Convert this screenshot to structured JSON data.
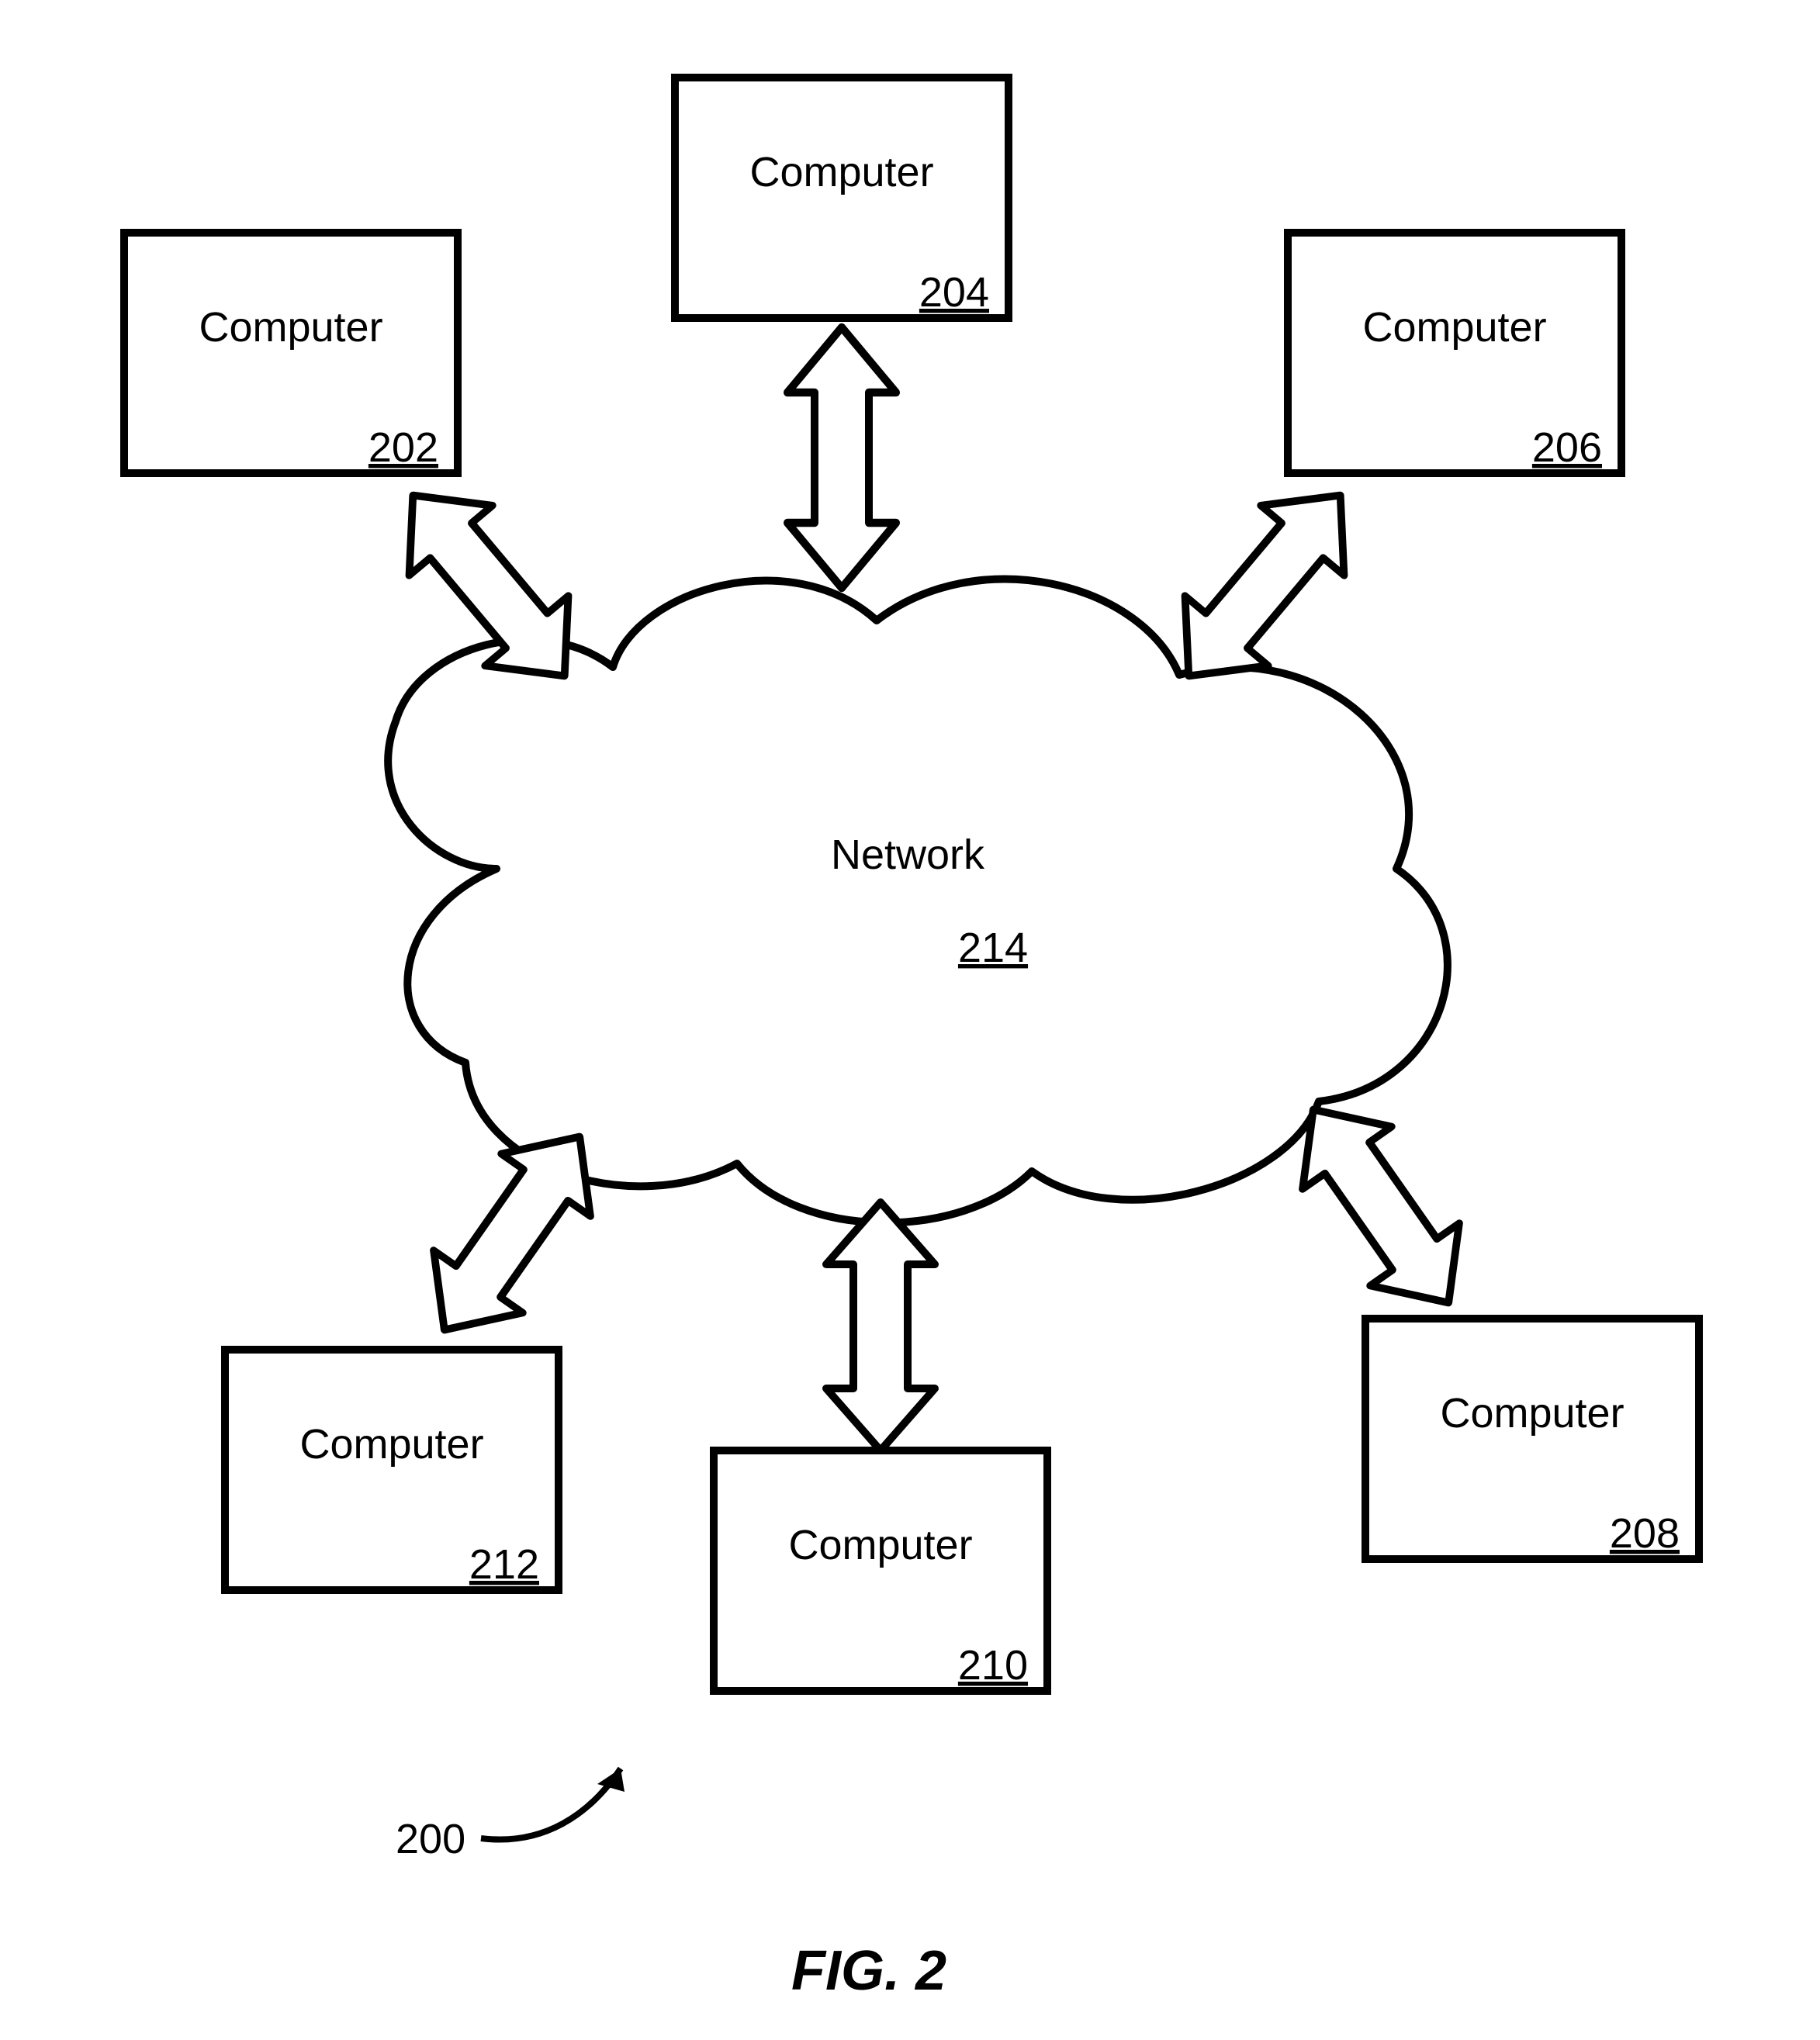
{
  "figure": {
    "caption": "FIG. 2",
    "overall_ref": "200"
  },
  "network": {
    "label": "Network",
    "ref": "214"
  },
  "nodes": {
    "n202": {
      "label": "Computer",
      "ref": "202"
    },
    "n204": {
      "label": "Computer",
      "ref": "204"
    },
    "n206": {
      "label": "Computer",
      "ref": "206"
    },
    "n208": {
      "label": "Computer",
      "ref": "208"
    },
    "n210": {
      "label": "Computer",
      "ref": "210"
    },
    "n212": {
      "label": "Computer",
      "ref": "212"
    }
  }
}
